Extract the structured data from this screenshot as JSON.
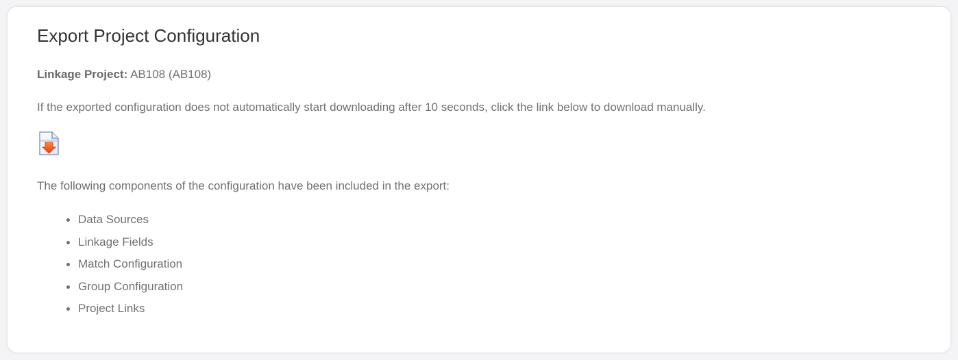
{
  "page": {
    "title": "Export Project Configuration"
  },
  "project": {
    "label": "Linkage Project:",
    "value": "AB108 (AB108)"
  },
  "instructions": "If the exported configuration does not automatically start downloading after 10 seconds, click the link below to download manually.",
  "download": {
    "icon": "file-download-icon"
  },
  "components": {
    "intro": "The following components of the configuration have been included in the export:",
    "items": [
      {
        "label": "Data Sources"
      },
      {
        "label": "Linkage Fields"
      },
      {
        "label": "Match Configuration"
      },
      {
        "label": "Group Configuration"
      },
      {
        "label": "Project Links"
      }
    ]
  },
  "colors": {
    "title_text": "#333333",
    "body_text": "#707070",
    "card_background": "#ffffff",
    "page_background": "#f4f4f6",
    "icon_arrow": "#f05a1a"
  }
}
